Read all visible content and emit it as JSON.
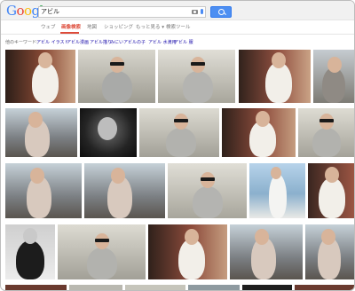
{
  "app": {
    "logo_letters": [
      "G",
      "o",
      "o",
      "g",
      "l",
      "e"
    ]
  },
  "search": {
    "query": "アビル",
    "placeholder": ""
  },
  "tabs": [
    {
      "label": "ウェブ",
      "active": false
    },
    {
      "label": "画像検索",
      "active": true
    },
    {
      "label": "地図",
      "active": false
    },
    {
      "label": "ショッピング",
      "active": false
    },
    {
      "label": "もっと見る ▾",
      "active": false
    },
    {
      "label": "検索ツール",
      "active": false
    }
  ],
  "related": {
    "label": "他のキーワード:",
    "links": [
      "アビル イラスト",
      "アビル漫画",
      "アビル描り",
      "みにいアビルの子",
      "アビル 水滴用",
      "アビル 服"
    ]
  },
  "colors": {
    "accent_red": "#dd4b39",
    "link_blue": "#1a0dab",
    "button_blue": "#4d8ff2"
  },
  "icons": [
    "camera-icon",
    "mic-icon",
    "search-icon"
  ]
}
